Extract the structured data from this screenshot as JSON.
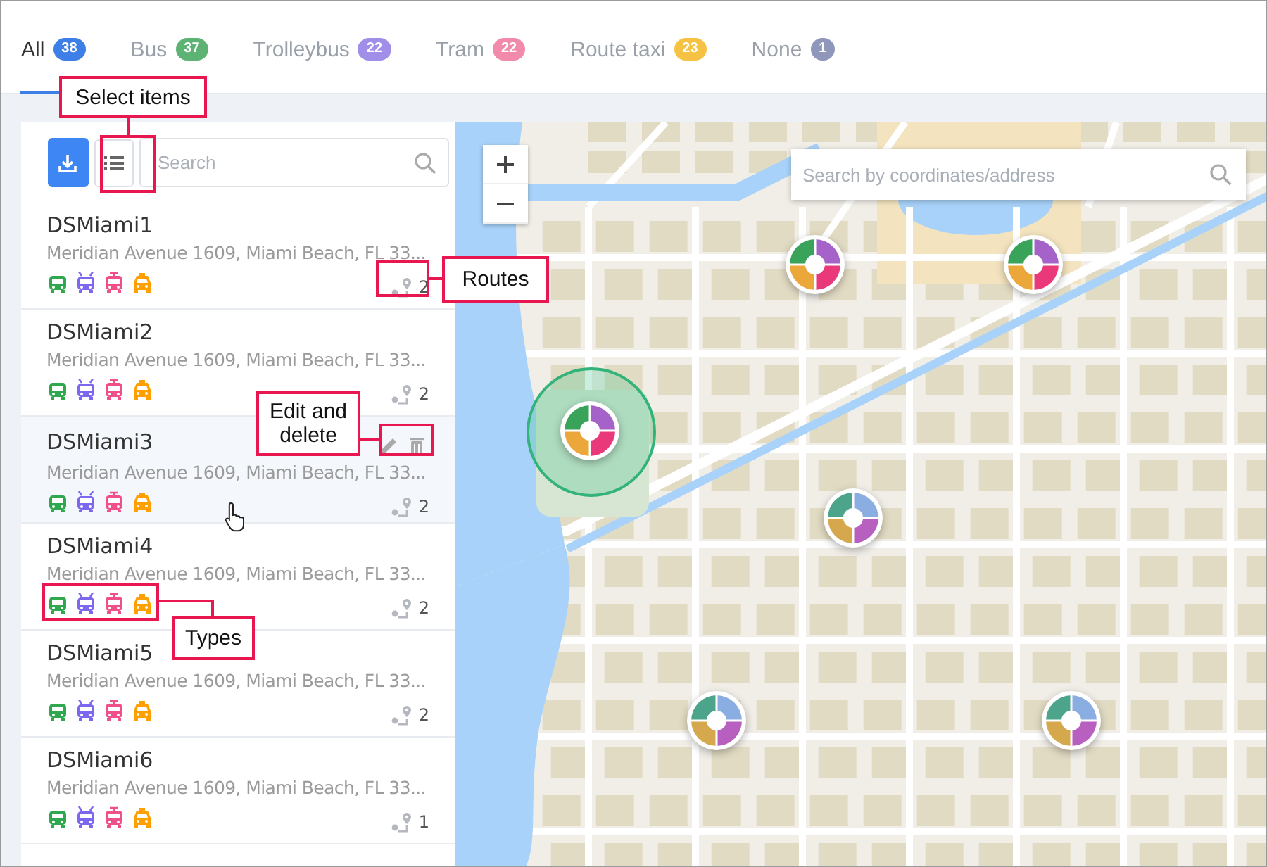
{
  "tabs": [
    {
      "label": "All",
      "count": "38",
      "color": "#3d7fe6",
      "selected": true
    },
    {
      "label": "Bus",
      "count": "37",
      "color": "#5db374",
      "selected": false
    },
    {
      "label": "Trolleybus",
      "count": "22",
      "color": "#a08ee8",
      "selected": false
    },
    {
      "label": "Tram",
      "count": "22",
      "color": "#f28bab",
      "selected": false
    },
    {
      "label": "Route taxi",
      "count": "23",
      "color": "#f6c244",
      "selected": false
    },
    {
      "label": "None",
      "count": "1",
      "color": "#8f98bb",
      "selected": false
    }
  ],
  "toolbar": {
    "search": {
      "placeholder": "Search"
    }
  },
  "stops": [
    {
      "name": "DSMiami1",
      "address": "Meridian Avenue 1609, Miami Beach, FL 33...",
      "routes": "2",
      "hovered": false
    },
    {
      "name": "DSMiami2",
      "address": "Meridian Avenue 1609, Miami Beach, FL 33...",
      "routes": "2",
      "hovered": false
    },
    {
      "name": "DSMiami3",
      "address": "Meridian Avenue 1609, Miami Beach, FL 33...",
      "routes": "2",
      "hovered": true
    },
    {
      "name": "DSMiami4",
      "address": "Meridian Avenue 1609, Miami Beach, FL 33...",
      "routes": "2",
      "hovered": false
    },
    {
      "name": "DSMiami5",
      "address": "Meridian Avenue 1609, Miami Beach, FL 33...",
      "routes": "2",
      "hovered": false
    },
    {
      "name": "DSMiami6",
      "address": "Meridian Avenue 1609, Miami Beach, FL 33...",
      "routes": "1",
      "hovered": false
    }
  ],
  "types": [
    {
      "kind": "bus",
      "color": "#2fa84f"
    },
    {
      "kind": "trolleybus",
      "color": "#7b68ee"
    },
    {
      "kind": "tram",
      "color": "#f0508a"
    },
    {
      "kind": "taxi",
      "color": "#ffa000"
    }
  ],
  "map": {
    "address_search": {
      "placeholder": "Search by coordinates/address"
    },
    "markers": [
      {
        "kind": "bright",
        "selected": false
      },
      {
        "kind": "bright",
        "selected": false
      },
      {
        "kind": "bright",
        "selected": true
      },
      {
        "kind": "muted",
        "selected": false
      },
      {
        "kind": "muted",
        "selected": false
      },
      {
        "kind": "muted",
        "selected": false
      }
    ]
  },
  "callouts": [
    {
      "text": "Select items"
    },
    {
      "text": "Routes"
    },
    {
      "text": "Edit and delete"
    },
    {
      "text": "Types"
    }
  ]
}
